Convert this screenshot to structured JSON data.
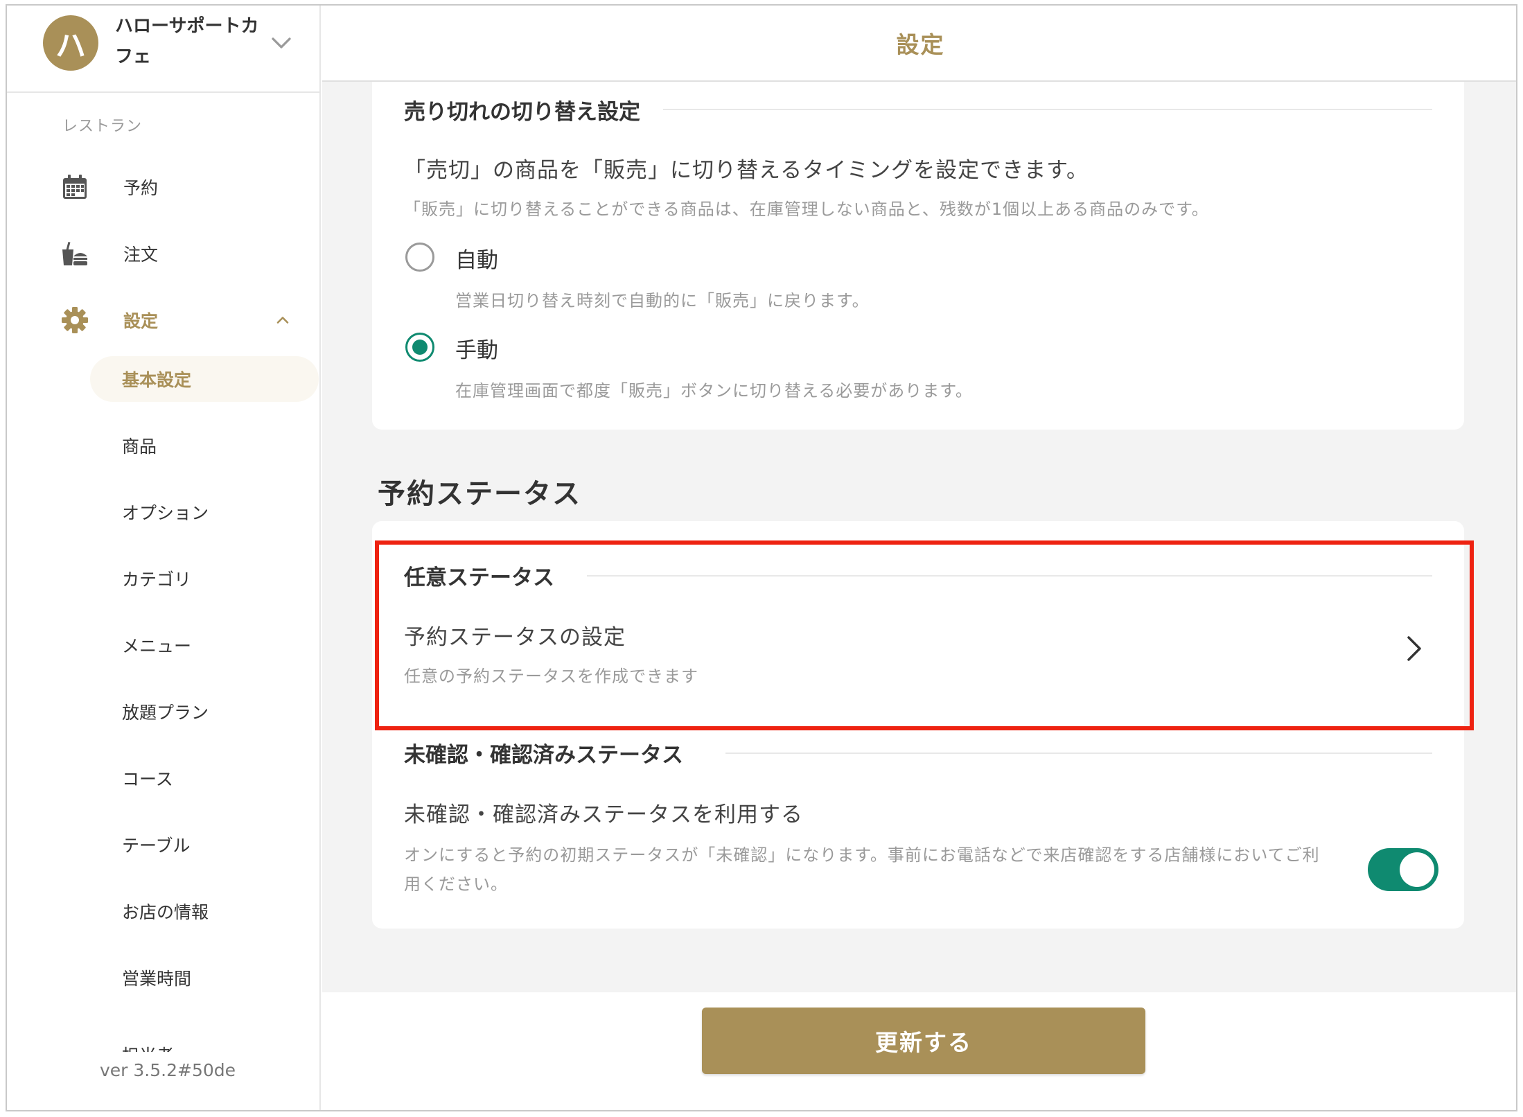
{
  "store": {
    "avatar_letter": "ハ",
    "name": "ハローサポートカフェ"
  },
  "sidebar": {
    "section_label": "レストラン",
    "items": [
      {
        "label": "予約",
        "icon": "calendar-icon"
      },
      {
        "label": "注文",
        "icon": "food-icon"
      },
      {
        "label": "設定",
        "icon": "gear-icon",
        "active": true
      }
    ],
    "sub_items": [
      {
        "label": "基本設定",
        "selected": true
      },
      {
        "label": "商品"
      },
      {
        "label": "オプション"
      },
      {
        "label": "カテゴリ"
      },
      {
        "label": "メニュー"
      },
      {
        "label": "放題プラン"
      },
      {
        "label": "コース"
      },
      {
        "label": "テーブル"
      },
      {
        "label": "お店の情報"
      },
      {
        "label": "営業時間"
      },
      {
        "label": "担当者"
      }
    ],
    "version": "ver 3.5.2#50de"
  },
  "header": {
    "title": "設定"
  },
  "soldout_section": {
    "heading": "売り切れの切り替え設定",
    "description": "「売切」の商品を「販売」に切り替えるタイミングを設定できます。",
    "note": "「販売」に切り替えることができる商品は、在庫管理しない商品と、残数が1個以上ある商品のみです。",
    "options": [
      {
        "label": "自動",
        "description": "営業日切り替え時刻で自動的に「販売」に戻ります。",
        "checked": false
      },
      {
        "label": "手動",
        "description": "在庫管理画面で都度「販売」ボタンに切り替える必要があります。",
        "checked": true
      }
    ]
  },
  "reservation_status": {
    "section_title": "予約ステータス",
    "custom": {
      "heading": "任意ステータス",
      "title": "予約ステータスの設定",
      "description": "任意の予約ステータスを作成できます"
    },
    "confirm": {
      "heading": "未確認・確認済みステータス",
      "title": "未確認・確認済みステータスを利用する",
      "description_line1": "オンにすると予約の初期ステータスが「未確認」になります。事前にお電話などで来店確認をする店舗様においてご利",
      "description_line2": "用ください。",
      "enabled": true
    }
  },
  "footer": {
    "submit_label": "更新する"
  },
  "colors": {
    "brand": "#a99058",
    "accent_green": "#0f8a70",
    "highlight_red": "#ee2211"
  }
}
